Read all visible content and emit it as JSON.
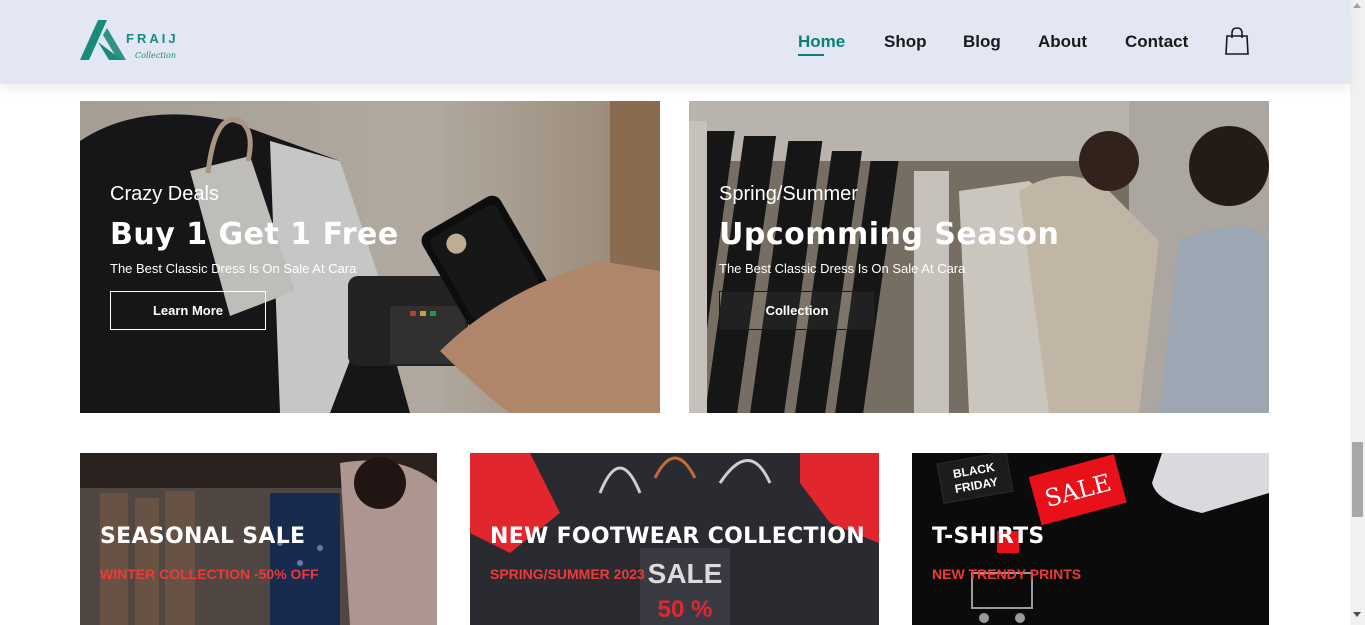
{
  "brand": {
    "name": "FRAIJ",
    "tagline": "Collection"
  },
  "nav": {
    "items": [
      {
        "label": "Home",
        "active": true
      },
      {
        "label": "Shop",
        "active": false
      },
      {
        "label": "Blog",
        "active": false
      },
      {
        "label": "About",
        "active": false
      },
      {
        "label": "Contact",
        "active": false
      }
    ],
    "cart_icon": "shopping-bag-icon"
  },
  "banners": [
    {
      "overline": "Crazy Deals",
      "title": "Buy 1 Get 1 Free",
      "description": "The Best Classic Dress Is On Sale At Cara",
      "button": "Learn More"
    },
    {
      "overline": "Spring/Summer",
      "title": "Upcomming Season",
      "description": "The Best Classic Dress Is On Sale At Cara",
      "button": "Collection"
    }
  ],
  "small_banners": [
    {
      "title": "SEASONAL SALE",
      "subtitle": "WINTER COLLECTION -50% OFF"
    },
    {
      "title": "NEW FOOTWEAR COLLECTION",
      "subtitle": "SPRING/SUMMER 2023",
      "image_text": {
        "sale": "SALE",
        "percent": "50 %"
      }
    },
    {
      "title": "T-SHIRTS",
      "subtitle": "NEW TRENDY PRINTS",
      "image_text": {
        "tag1": "BLACK",
        "tag2": "FRIDAY",
        "sale": "SALE"
      }
    }
  ],
  "colors": {
    "accent": "#088178",
    "header_bg": "#e3e6f3",
    "sale_red": "#ec3a3a"
  }
}
